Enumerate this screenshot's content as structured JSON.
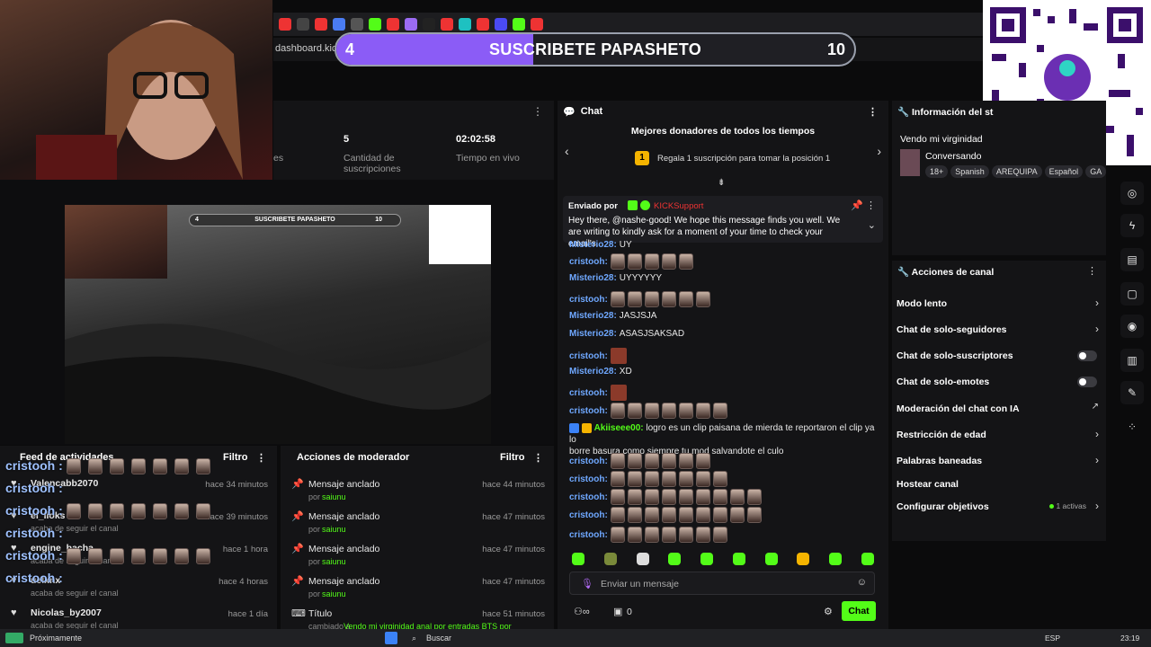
{
  "browser": {
    "url_fragment": "dashboard.kick"
  },
  "goal_banner": {
    "left_value": "4",
    "title": "SUSCRIBETE PAPASHETO",
    "right_value": "10",
    "progress_fraction": 0.38,
    "color": "#8b5cf6"
  },
  "stats": {
    "partial_label": "es",
    "subs_count": "5",
    "subs_label": "Cantidad de suscripciones",
    "live_time": "02:02:58",
    "live_label": "Tiempo en vivo"
  },
  "preview_overlay": {
    "left_value": "4",
    "title": "SUSCRIBETE PAPASHETO",
    "right_value": "10"
  },
  "feed": {
    "title": "Feed de actividades",
    "filter": "Filtro",
    "items": [
      {
        "name": "Valencabb2070",
        "time": "hace 34 minutos",
        "sub": ""
      },
      {
        "name": "el_lioks",
        "time": "hace 39 minutos",
        "sub": "acaba de seguir el canal"
      },
      {
        "name": "engine_bacha",
        "time": "hace 1 hora",
        "sub": "acaba de seguir el canal"
      },
      {
        "name": "uelxnx",
        "time": "hace 4 horas",
        "sub": "acaba de seguir el canal"
      },
      {
        "name": "Nicolas_by2007",
        "time": "hace 1 día",
        "sub": "acaba de seguir el canal"
      }
    ],
    "overlay_user": "cristooh :"
  },
  "moderator": {
    "title": "Acciones de moderador",
    "filter": "Filtro",
    "items": [
      {
        "title": "Mensaje anclado",
        "by": "por",
        "user": "saiunu",
        "time": "hace 44 minutos"
      },
      {
        "title": "Mensaje anclado",
        "by": "por",
        "user": "saiunu",
        "time": "hace 47 minutos"
      },
      {
        "title": "Mensaje anclado",
        "by": "por",
        "user": "saiunu",
        "time": "hace 47 minutos"
      },
      {
        "title": "Mensaje anclado",
        "by": "por",
        "user": "saiunu",
        "time": "hace 47 minutos"
      },
      {
        "title": "Título",
        "by": "cambiado a",
        "user": "Vendo mi virginidad anal por entradas BTS por",
        "time": "hace 51 minutos"
      }
    ]
  },
  "chat": {
    "title": "Chat",
    "donors_title": "Mejores donadores de todos los tiempos",
    "donors_rank": "1",
    "donors_prompt": "Regala 1 suscripción para tomar la posición 1",
    "pinned_label": "Enviado por",
    "pinned_user": "KICKSupport",
    "pinned_text": "Hey there, @nashe-good! We hope this message finds you well. We are writing to kindly ask for a moment of your time to check your email's...",
    "messages": [
      {
        "user": "Misterio28:",
        "text": "UY",
        "emotes": 0
      },
      {
        "user": "cristooh:",
        "text": "",
        "emotes": 5
      },
      {
        "user": "Misterio28:",
        "text": "UYYYYYY",
        "emotes": 0
      },
      {
        "user": "cristooh:",
        "text": "",
        "emotes": 6
      },
      {
        "user": "Misterio28:",
        "text": "JASJSJA",
        "emotes": 0
      },
      {
        "user": "Misterio28:",
        "text": "ASASJSAKSAD",
        "emotes": 0
      },
      {
        "user": "cristooh:",
        "text": "",
        "emotes": 1
      },
      {
        "user": "Misterio28:",
        "text": "XD",
        "emotes": 0
      },
      {
        "user": "cristooh:",
        "text": "",
        "emotes": 1
      },
      {
        "user": "cristooh:",
        "text": "",
        "emotes": 7
      }
    ],
    "akii_user": "Akiiseee00:",
    "akii_text_1": "logro es un clip paisana de mierda te reportaron el clip ya lo",
    "akii_text_2": "borre basura como siempre tu mod salvandote el culo",
    "messages_after": [
      {
        "user": "cristooh:",
        "emotes": 6
      },
      {
        "user": "cristooh:",
        "emotes": 7
      },
      {
        "user": "cristooh:",
        "emotes": 9
      },
      {
        "user": "cristooh:",
        "emotes": 9
      },
      {
        "user": "cristooh:",
        "emotes": 7
      }
    ],
    "input_placeholder": "Enviar un mensaje",
    "viewers": "0",
    "send_label": "Chat"
  },
  "info": {
    "title": "Información del st",
    "stream_title": "Vendo mi virginidad",
    "category": "Conversando",
    "tags": [
      "18+",
      "Spanish",
      "AREQUIPA",
      "Español",
      "GA"
    ]
  },
  "actions": {
    "title": "Acciones de canal",
    "items": [
      {
        "label": "Modo lento",
        "control": "chevron"
      },
      {
        "label": "Chat de solo-seguidores",
        "control": "chevron"
      },
      {
        "label": "Chat de solo-suscriptores",
        "control": "toggle"
      },
      {
        "label": "Chat de solo-emotes",
        "control": "toggle"
      },
      {
        "label": "Moderación del chat con IA",
        "control": "external"
      },
      {
        "label": "Restricción de edad",
        "control": "chevron"
      },
      {
        "label": "Palabras baneadas",
        "control": "chevron"
      },
      {
        "label": "Hostear canal",
        "control": "none"
      },
      {
        "label": "Configurar objetivos",
        "control": "chevron"
      }
    ],
    "goals_active": "1 activas"
  },
  "taskbar": {
    "notice": "Próximamente",
    "search": "Buscar",
    "lang": "ESP",
    "time": "23:19"
  },
  "colors": {
    "accent_green": "#53fc18",
    "username_blue": "#6fa8ff",
    "purple": "#8b5cf6"
  }
}
